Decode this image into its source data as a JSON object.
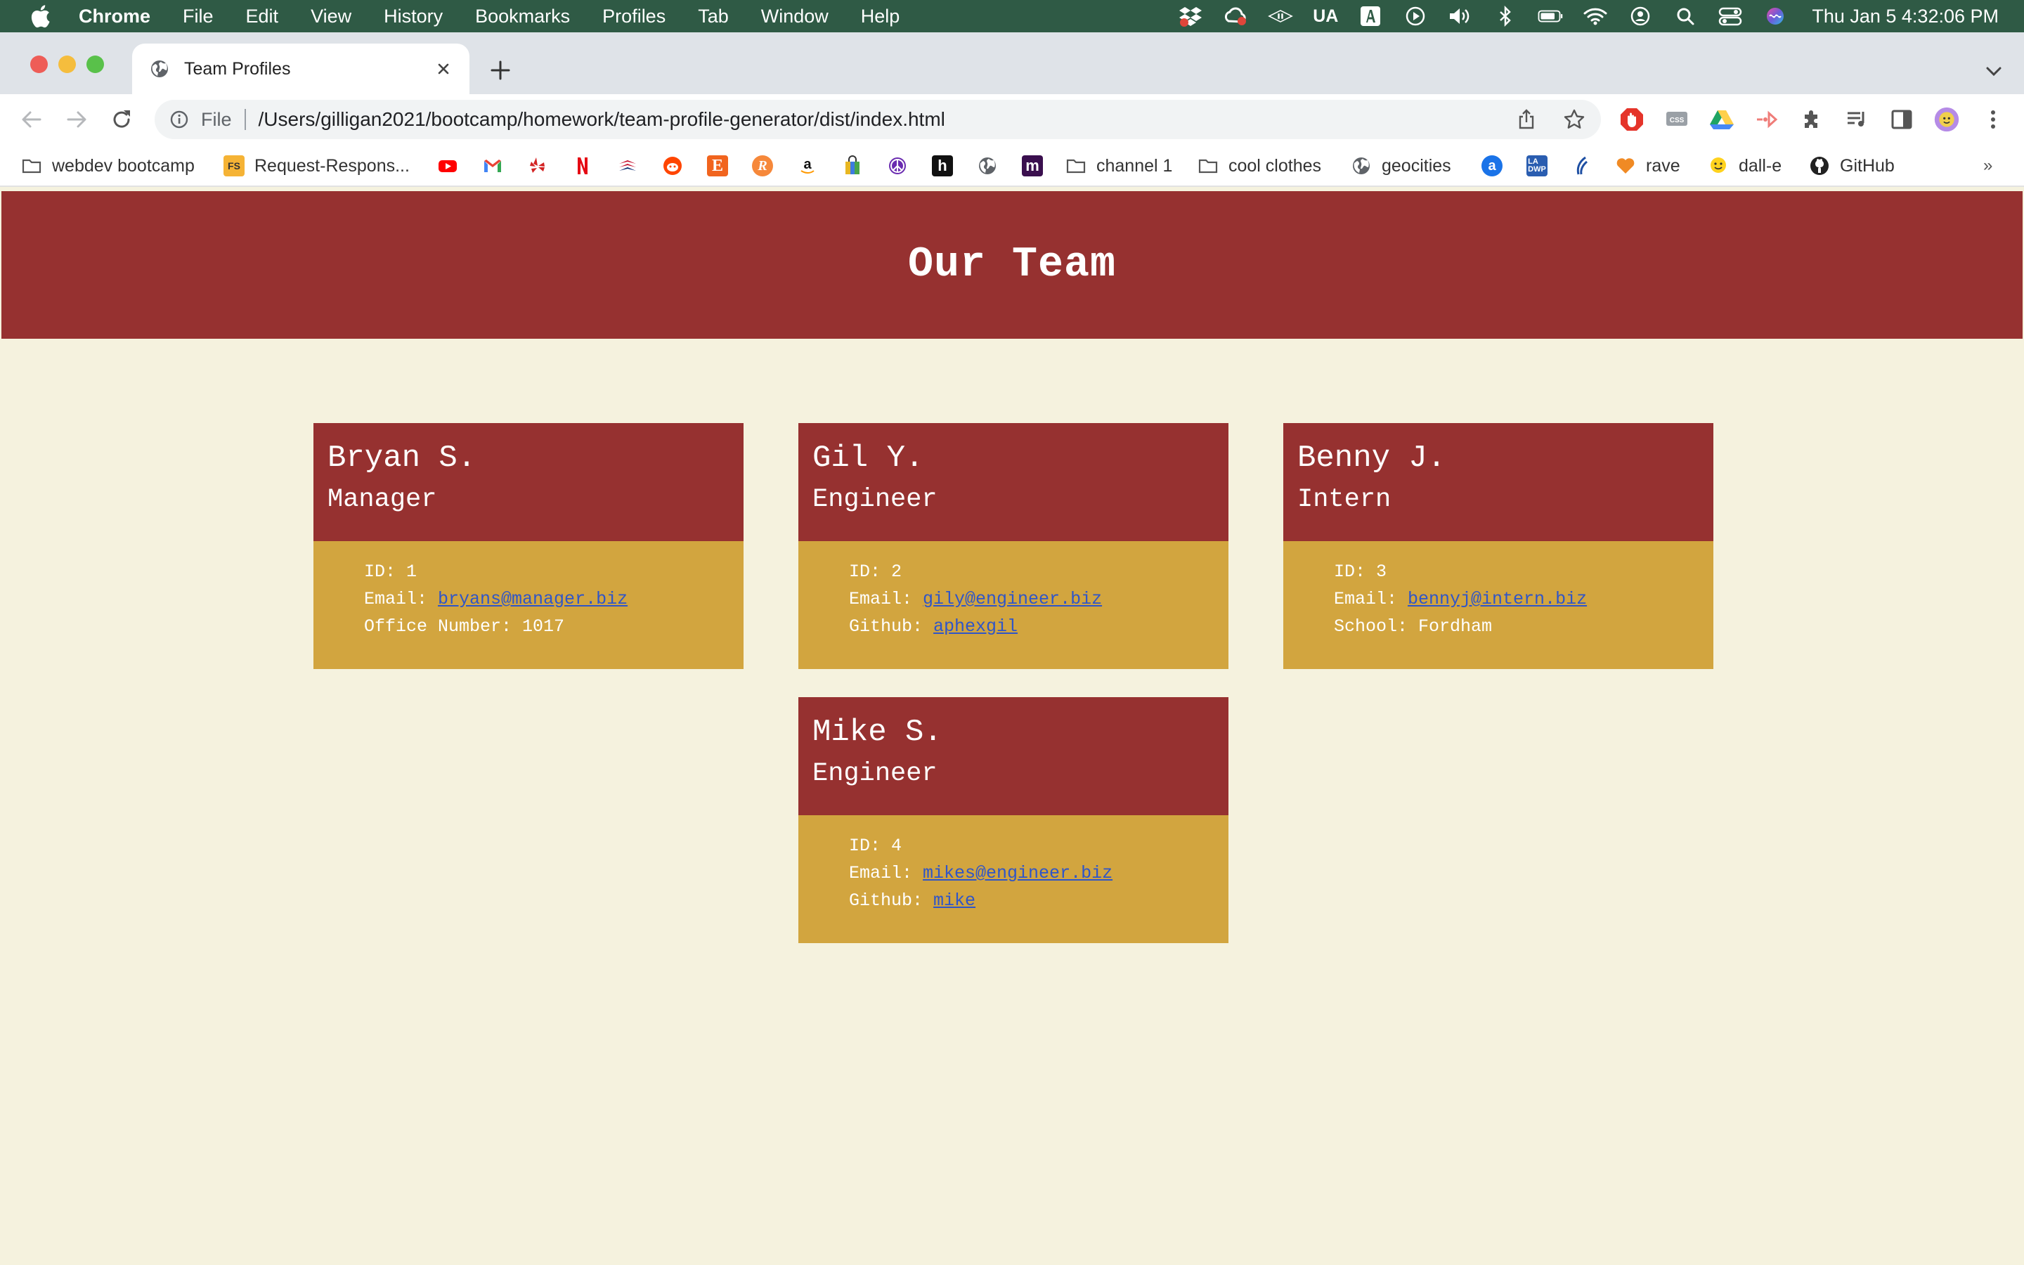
{
  "menubar": {
    "app": "Chrome",
    "items": [
      "File",
      "Edit",
      "View",
      "History",
      "Bookmarks",
      "Profiles",
      "Tab",
      "Window",
      "Help"
    ],
    "status_text": "UA",
    "clock": "Thu Jan 5  4:32:06 PM"
  },
  "tab": {
    "title": "Team Profiles"
  },
  "omnibox": {
    "scheme": "File",
    "url": "/Users/gilligan2021/bootcamp/homework/team-profile-generator/dist/index.html"
  },
  "bookmarks": {
    "webdev": "webdev bootcamp",
    "request": "Request-Respons...",
    "channel1": "channel 1",
    "coolclothes": "cool clothes",
    "geocities": "geocities",
    "rave": "rave",
    "dalle": "dall-e",
    "github": "GitHub"
  },
  "page": {
    "title": "Our Team",
    "cards": [
      {
        "name": "Bryan S.",
        "role": "Manager",
        "id_label": "ID: 1",
        "email_label": "Email: ",
        "email": "bryans@manager.biz",
        "extra_label": "Office Number: 1017",
        "extra_link": ""
      },
      {
        "name": "Gil Y.",
        "role": "Engineer",
        "id_label": "ID: 2",
        "email_label": "Email: ",
        "email": "gily@engineer.biz",
        "extra_label": "Github: ",
        "extra_link": "aphexgil"
      },
      {
        "name": "Benny J.",
        "role": "Intern",
        "id_label": "ID: 3",
        "email_label": "Email: ",
        "email": "bennyj@intern.biz",
        "extra_label": "School: Fordham",
        "extra_link": ""
      },
      {
        "name": "Mike S.",
        "role": "Engineer",
        "id_label": "ID: 4",
        "email_label": "Email: ",
        "email": "mikes@engineer.biz",
        "extra_label": "Github: ",
        "extra_link": "mike"
      }
    ]
  },
  "colors": {
    "header_bg": "#963130",
    "card_body_bg": "#d2a53f",
    "page_bg": "#f5f2de",
    "link": "#2f55c8",
    "menubar_bg": "#2f5a45"
  }
}
